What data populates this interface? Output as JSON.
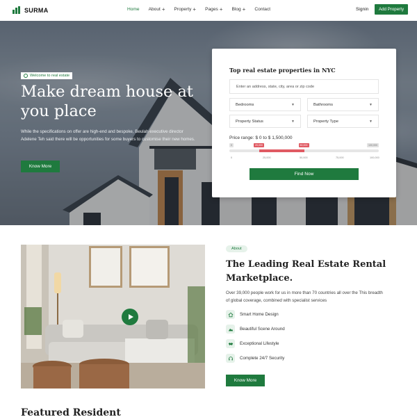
{
  "brand": {
    "name": "SURMA",
    "accent": "#1f7a3e"
  },
  "nav": {
    "items": [
      {
        "label": "Home",
        "has_plus": false
      },
      {
        "label": "About",
        "has_plus": true
      },
      {
        "label": "Property",
        "has_plus": true
      },
      {
        "label": "Pages",
        "has_plus": true
      },
      {
        "label": "Blog",
        "has_plus": true
      },
      {
        "label": "Contact",
        "has_plus": false
      }
    ],
    "signin": "Signin",
    "add_property": "Add Property"
  },
  "hero": {
    "badge": "Welcome to real estate",
    "title": "Make dream house at you place",
    "text": "While the specifications on offer are high-end and bespoke, Beulah executive director Adelene Teh said there will be opportunities for some buyers to customise their new homes.",
    "button": "Know More"
  },
  "search": {
    "title": "Top real estate properties in NYC",
    "address_placeholder": "Enter an address, state, city, area or zip code",
    "bedrooms": "Bedrooms",
    "bathrooms": "Bathrooms",
    "property_status": "Property Status",
    "property_type": "Property Type",
    "price_label": "Price range: $ 0 to $ 1,500,000",
    "range": {
      "min_label": "0",
      "low_label": "20,000",
      "high_label": "60,000",
      "max_label": "100,000",
      "low_fraction": 0.2,
      "high_fraction": 0.5,
      "ticks": [
        "0",
        "25,000",
        "50,000",
        "75,000",
        "100,000"
      ]
    },
    "button": "Find Now"
  },
  "about": {
    "badge": "About",
    "title": "The Leading Real Estate Rental Marketplace.",
    "text": "Over 39,000 people work for us in more than 70 countries all over the This breadth of global coverage, combined with specialist services",
    "features": [
      {
        "label": "Smart Home Design",
        "icon": "house-icon"
      },
      {
        "label": "Beautiful Scene Around",
        "icon": "landscape-icon"
      },
      {
        "label": "Exceptional Lifestyle",
        "icon": "handshake-icon"
      },
      {
        "label": "Complete 24/7 Security",
        "icon": "headset-icon"
      }
    ],
    "button": "Know More"
  },
  "featured": {
    "title": "Featured Resident"
  }
}
